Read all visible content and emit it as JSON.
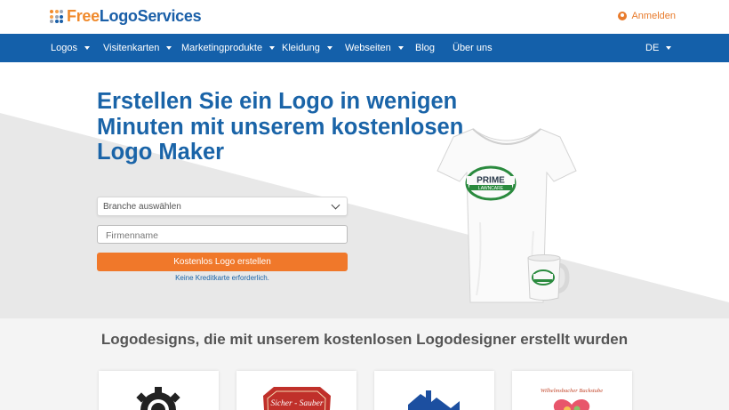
{
  "header": {
    "logo_free": "Free",
    "logo_rest": "LogoServices",
    "login_label": "Anmelden",
    "colors": {
      "brand_orange": "#f08a2c",
      "brand_blue": "#1a5fa8"
    }
  },
  "nav": {
    "items": [
      {
        "label": "Logos",
        "dropdown": true
      },
      {
        "label": "Visitenkarten",
        "dropdown": true
      },
      {
        "label": "Marketingprodukte",
        "dropdown": true
      },
      {
        "label": "Kleidung",
        "dropdown": true
      },
      {
        "label": "Webseiten",
        "dropdown": true
      },
      {
        "label": "Blog",
        "dropdown": false
      },
      {
        "label": "Über uns",
        "dropdown": false
      }
    ],
    "language": "DE",
    "background": "#1460aa"
  },
  "hero": {
    "title": "Erstellen Sie ein Logo in wenigen Minuten mit unserem kostenlosen Logo Maker",
    "industry_select": {
      "value": "Branche auswählen"
    },
    "company_input": {
      "placeholder": "Firmenname",
      "value": ""
    },
    "cta_label": "Kostenlos Logo erstellen",
    "note": "Keine Kreditkarte erforderlich.",
    "product_logo": {
      "line1": "PRIME",
      "line2": "LAWNCARE"
    },
    "cta_color": "#f0782a"
  },
  "gallery": {
    "title": "Logodesigns, die mit unserem kostenlosen Logodesigner erstellt wurden",
    "cards": [
      {
        "icon": "gear-logo-icon"
      },
      {
        "icon": "badge-logo-icon",
        "text": "Sicher - Sauber"
      },
      {
        "icon": "house-logo-icon"
      },
      {
        "icon": "heart-logo-icon",
        "text": "Wilhelmsbacher Backstube"
      }
    ]
  }
}
